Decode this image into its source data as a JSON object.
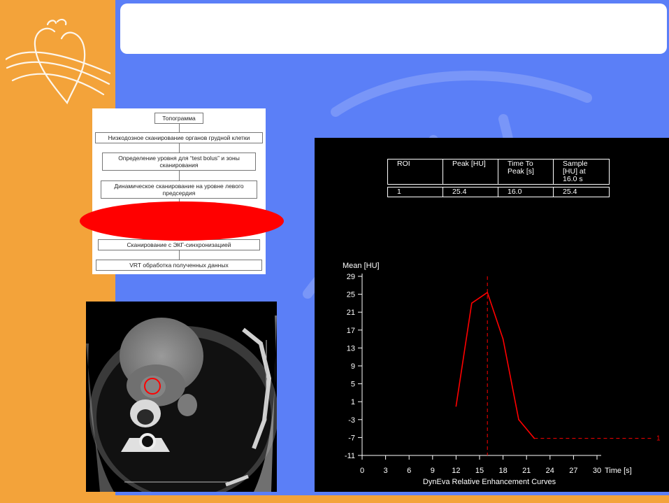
{
  "slide": {
    "title": "",
    "colors": {
      "orange": "#f3a33a",
      "blue": "#5b7ff7",
      "red": "#ff0000"
    }
  },
  "flowchart": {
    "steps": [
      "Топограмма",
      "Низкодозное сканирование органов грудной клетки",
      "Определение уровня для “test bolus” и зоны сканирования",
      "Динамическое сканирование на уровне левого предсердия",
      "Сканирование с ЭКГ-синхронизацией",
      "VRT обработка полученных данных"
    ]
  },
  "roi_table": {
    "headers": [
      "ROI",
      "Peak [HU]",
      "Time To Peak [s]",
      "Sample [HU] at 16.0 s"
    ],
    "rows": [
      [
        "1",
        "25.4",
        "16.0",
        "25.4"
      ]
    ]
  },
  "chart_data": {
    "type": "line",
    "title": "DynEva Relative Enhancement Curves",
    "xlabel": "Time [s]",
    "ylabel": "Mean [HU]",
    "xlim": [
      0,
      30
    ],
    "ylim": [
      -11,
      29
    ],
    "xticks": [
      0,
      3,
      6,
      9,
      12,
      15,
      18,
      21,
      24,
      27,
      30
    ],
    "yticks": [
      29,
      25,
      21,
      17,
      13,
      9,
      5,
      1,
      -3,
      -7,
      -11
    ],
    "peak_marker_x": 16,
    "series": [
      {
        "name": "1",
        "color": "#ff0000",
        "x": [
          12,
          14,
          16,
          18,
          20,
          22
        ],
        "y": [
          0,
          23,
          25.4,
          15,
          -3,
          -7.2
        ],
        "extension": {
          "from_x": 22,
          "to_x": 38,
          "y": -7.2,
          "style": "dashed"
        }
      }
    ]
  }
}
